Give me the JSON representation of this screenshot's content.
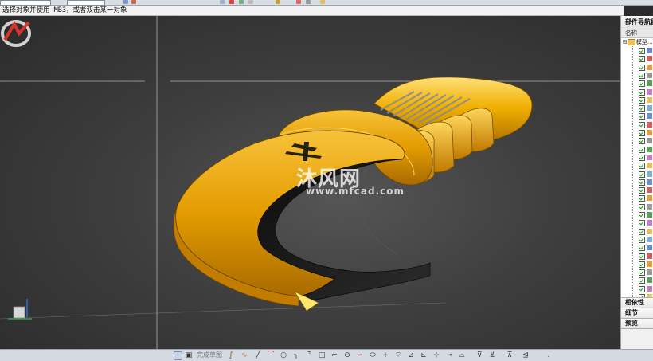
{
  "status_prompt": "选择对象并使用 MB3，或者双击某一对象",
  "nav": {
    "title": "部件导航器",
    "column_name": "名称",
    "root_label": "模型...",
    "sections": [
      "相依性",
      "细节",
      "预览"
    ]
  },
  "watermark": {
    "brand": "沐风网",
    "url": "www.mfcad.com"
  },
  "sketch_toolbar": {
    "finish_label": "完成草图"
  },
  "colors": {
    "part_gold": "#e8a400",
    "part_dark": "#1a1a1a",
    "viewport_bg": "#3e3e3e",
    "panel_bg": "#f0f0f0"
  }
}
